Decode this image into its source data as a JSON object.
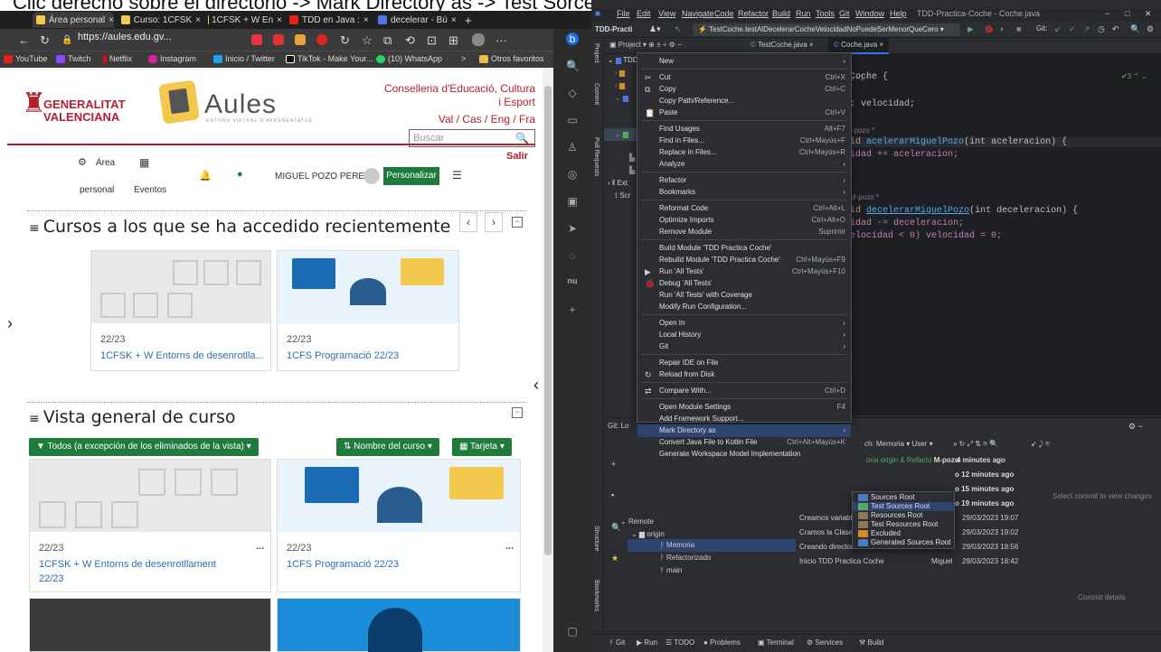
{
  "caption": "Clic derecho sobre el directorio -> Mark Directory as -> Test Sorces Root",
  "browser": {
    "tabs": [
      {
        "label": "Área personal",
        "color": "#f2c94c"
      },
      {
        "label": "Curso: 1CFSK",
        "color": "#f2c94c"
      },
      {
        "label": "1CFSK + W En",
        "color": "#f2c94c"
      },
      {
        "label": "TDD en Java :",
        "color": "#e62117"
      },
      {
        "label": "decelerar - Bú",
        "color": "#4a78e0"
      }
    ],
    "url": "https://aules.edu.gv...",
    "bookmarks": [
      "YouTube",
      "Twitch",
      "Netflix",
      "Instagram",
      "Inicio / Twitter",
      "TikTok - Make Your...",
      "(10) WhatsApp",
      "Otros favoritos"
    ],
    "header": {
      "org": "GENERALITAT VALENCIANA",
      "app_title": "Aules",
      "app_subtitle": "ENTORN VIRTUAL D'APRENENTATGE",
      "conselleria": "Conselleria d'Educació, Cultura i Esport",
      "languages": "Val / Cas / Eng / Fra",
      "search_placeholder": "Buscar",
      "salir": "Salir"
    },
    "nav": {
      "area_personal_1": "Área",
      "area_personal_2": "personal",
      "eventos": "Eventos",
      "user_name": "MIGUEL POZO PEREZ",
      "personalizar": "Personalizar"
    },
    "recent": {
      "title": "Cursos a los que se ha accedido recientemente",
      "cards": [
        {
          "date": "22/23",
          "name": "1CFSK + W Entorns de desenrotlla..."
        },
        {
          "date": "22/23",
          "name": "1CFS Programació 22/23"
        }
      ]
    },
    "overview": {
      "title": "Vista general de curso",
      "filter": "Todos (a excepción de los eliminados de la vista)",
      "sort": "Nombre del curso",
      "view": "Tarjeta",
      "cards": [
        {
          "date": "22/23",
          "name": "1CFSK + W Entorns de desenrotllament",
          "name2": "22/23",
          "more": "..."
        },
        {
          "date": "22/23",
          "name": "1CFS Programació 22/23",
          "name2": "",
          "more": "..."
        }
      ]
    }
  },
  "ide": {
    "title": "TDD-Practica-Coche - Coche.java",
    "menu": [
      "File",
      "Edit",
      "View",
      "Navigate",
      "Code",
      "Refactor",
      "Build",
      "Run",
      "Tools",
      "Git",
      "Window",
      "Help"
    ],
    "run_config": "TestCoche.testAlDecelerarCocheVelocidadNoPuedeSerMenorQueCero",
    "project_label": "TDD-Practi",
    "tabs": [
      "Project",
      "TestCoche.java",
      "Coche.java"
    ],
    "code": {
      "l1": "o +1 *",
      "l2": "Coche {",
      "l3": ": velocidad;",
      "l4": "l-pozo *",
      "l5_kw": "id",
      "l5_fn": "acelerarMiguelPozo",
      "l5_rest": "(int aceleracion) {",
      "l6": "idad += aceleracion;",
      "l7": "M-pozo *",
      "l8_kw": "id",
      "l8_fn": "decelerarMiguelPozo",
      "l8_rest": "(int deceleracion) {",
      "l9": "idad -= deceleracion;",
      "l10": "elocidad < 0) velocidad = 0;",
      "warnings": "3"
    },
    "context_menu": [
      {
        "label": "New",
        "shortcut": "",
        "submenu": true
      },
      {
        "label": "Cut",
        "shortcut": "Ctrl+X",
        "icon": "✂"
      },
      {
        "label": "Copy",
        "shortcut": "Ctrl+C",
        "icon": "⧉"
      },
      {
        "label": "Copy Path/Reference...",
        "shortcut": ""
      },
      {
        "label": "Paste",
        "shortcut": "Ctrl+V",
        "icon": "📋"
      },
      {
        "label": "Find Usages",
        "shortcut": "Alt+F7"
      },
      {
        "label": "Find in Files...",
        "shortcut": "Ctrl+Mayús+F"
      },
      {
        "label": "Replace in Files...",
        "shortcut": "Ctrl+Mayús+R"
      },
      {
        "label": "Analyze",
        "shortcut": "",
        "submenu": true
      },
      {
        "label": "Refactor",
        "shortcut": "",
        "submenu": true
      },
      {
        "label": "Bookmarks",
        "shortcut": "",
        "submenu": true
      },
      {
        "label": "Reformat Code",
        "shortcut": "Ctrl+Alt+L"
      },
      {
        "label": "Optimize Imports",
        "shortcut": "Ctrl+Alt+O"
      },
      {
        "label": "Remove Module",
        "shortcut": "Suprimir"
      },
      {
        "label": "Build Module 'TDD Practica Coche'",
        "shortcut": ""
      },
      {
        "label": "Rebuild Module 'TDD Practica Coche'",
        "shortcut": "Ctrl+Mayús+F9"
      },
      {
        "label": "Run 'All Tests'",
        "shortcut": "Ctrl+Mayús+F10",
        "icon": "▶"
      },
      {
        "label": "Debug 'All Tests'",
        "shortcut": "",
        "icon": "🐞"
      },
      {
        "label": "Run 'All Tests' with Coverage",
        "shortcut": ""
      },
      {
        "label": "Modify Run Configuration...",
        "shortcut": ""
      },
      {
        "label": "Open In",
        "shortcut": "",
        "submenu": true
      },
      {
        "label": "Local History",
        "shortcut": "",
        "submenu": true
      },
      {
        "label": "Git",
        "shortcut": "",
        "submenu": true
      },
      {
        "label": "Repair IDE on File",
        "shortcut": ""
      },
      {
        "label": "Reload from Disk",
        "shortcut": "",
        "icon": "↻"
      },
      {
        "label": "Compare With...",
        "shortcut": "Ctrl+D",
        "icon": "⇄"
      },
      {
        "label": "Open Module Settings",
        "shortcut": "F4"
      },
      {
        "label": "Add Framework Support...",
        "shortcut": ""
      },
      {
        "label": "Mark Directory as",
        "shortcut": "",
        "submenu": true,
        "selected": true
      },
      {
        "label": "Convert Java File to Kotlin File",
        "shortcut": "Ctrl+Alt+Mayús+K"
      },
      {
        "label": "Generate Workspace Model Implementation",
        "shortcut": ""
      }
    ],
    "submenu": [
      {
        "label": "Sources Root",
        "color": "#4a7cc2"
      },
      {
        "label": "Test Sources Root",
        "color": "#5aa860",
        "selected": true
      },
      {
        "label": "Resources Root",
        "color": "#8a7a55"
      },
      {
        "label": "Test Resources Root",
        "color": "#8a7a55"
      },
      {
        "label": "Excluded",
        "color": "#d38a2b"
      },
      {
        "label": "Generated Sources Root",
        "color": "#4a7cc2"
      }
    ],
    "git": {
      "branch_label": "ch: Memoria",
      "user_label": "User",
      "remote": "Remote",
      "origin": "origin",
      "branches": [
        "Memoria",
        "Refactorizado",
        "main"
      ],
      "commits": [
        {
          "msg": "oria origin & Refacto",
          "author": "M-pozo",
          "time": "4 minutes ago"
        },
        {
          "msg": "",
          "author": "o",
          "time": "12 minutes ago"
        },
        {
          "msg": "",
          "author": "o",
          "time": "15 minutes ago"
        },
        {
          "msg": "",
          "author": "o",
          "time": "19 minutes ago"
        },
        {
          "msg": "Creamos variable",
          "author": "",
          "time": "29/03/2023 19:07"
        },
        {
          "msg": "Cramos la Clase C",
          "author": "",
          "time": "29/03/2023 19:02"
        },
        {
          "msg": "Creando directorio",
          "author": "",
          "time": "29/03/2023 18:56"
        },
        {
          "msg": "Inicio TDD Practica Coche",
          "author": "Miguel",
          "time": "29/03/2023 18:42"
        }
      ],
      "select_hint": "Select commit to view changes",
      "commit_details": "Commit details"
    },
    "statusbar": [
      "Git",
      "Run",
      "TODO",
      "Problems",
      "Terminal",
      "Services",
      "Build"
    ]
  }
}
